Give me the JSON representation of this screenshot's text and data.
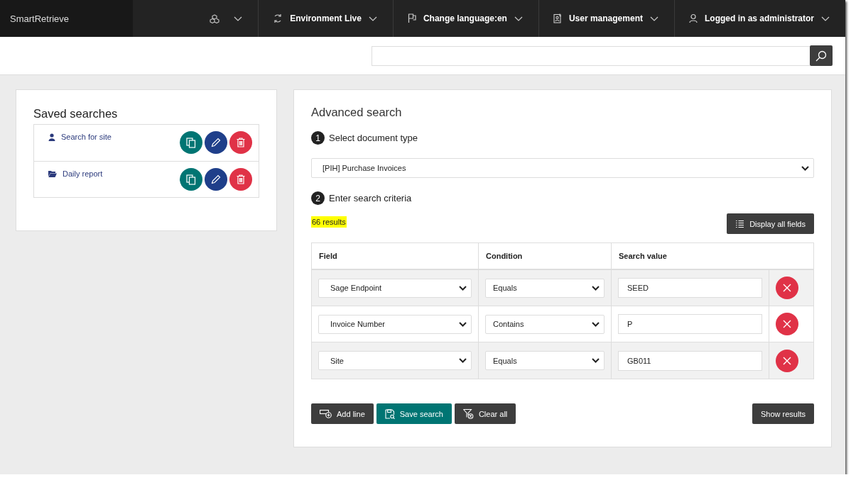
{
  "brand": "SmartRetrieve",
  "nav": [
    {
      "label": "Environment Live"
    },
    {
      "label": "Change language:en"
    },
    {
      "label": "User management"
    },
    {
      "label": "Logged in as administrator"
    }
  ],
  "saved_searches": {
    "title": "Saved searches",
    "items": [
      {
        "label": "Search for site",
        "kind": "user"
      },
      {
        "label": "Daily report",
        "kind": "folder"
      }
    ]
  },
  "advanced_search": {
    "title": "Advanced search",
    "step_1": {
      "number": "1",
      "label": "Select document type"
    },
    "document_type": "[PIH] Purchase Invoices",
    "step_2": {
      "number": "2",
      "label": "Enter search criteria"
    },
    "result_count": "66 results",
    "display_all_button": "Display all fields",
    "table": {
      "columns": [
        "Field",
        "Condition",
        "Search value"
      ],
      "rows": [
        {
          "field": "Sage Endpoint",
          "condition": "Equals",
          "value": "SEED"
        },
        {
          "field": "Invoice Number",
          "condition": "Contains",
          "value": "P"
        },
        {
          "field": "Site",
          "condition": "Equals",
          "value": "GB011"
        }
      ]
    },
    "buttons": [
      {
        "label": "Add line",
        "kind": "add"
      },
      {
        "label": "Save search",
        "kind": "save"
      },
      {
        "label": "Clear all",
        "kind": "clear"
      }
    ],
    "show_results_button": "Show results"
  }
}
